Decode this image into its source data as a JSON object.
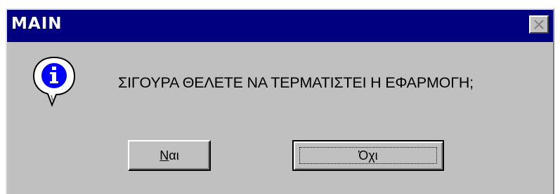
{
  "window": {
    "title": "MAIN",
    "close_icon": "close-icon"
  },
  "dialog": {
    "icon": "info-icon",
    "message": "ΣΙΓΟΥΡΑ ΘΕΛΕΤΕ ΝΑ ΤΕΡΜΑΤΙΣΤΕΙ Η ΕΦΑΡΜΟΓΗ;",
    "buttons": {
      "yes_label": "Ναι",
      "no_label": "Όχι"
    }
  },
  "colors": {
    "titlebar": "#000080",
    "dialog_background": "#c0c0c0",
    "icon_blue": "#0000ff"
  }
}
